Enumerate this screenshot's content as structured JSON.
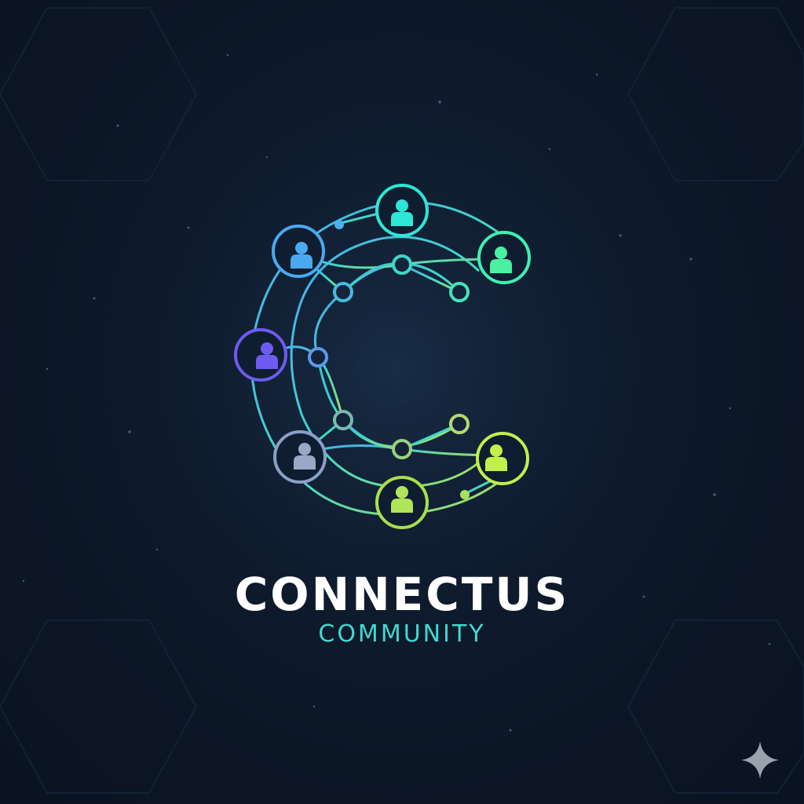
{
  "brand": {
    "name": "CONNECTUS",
    "tagline": "COMMUNITY"
  },
  "colors": {
    "background": "#0d1828",
    "name_text": "#ffffff",
    "tagline_text": "#3fd9d2",
    "gradient_cyan": "#2ee6d6",
    "gradient_blue": "#4aa8f0",
    "gradient_purple": "#6d5cf0",
    "gradient_lime": "#b8f04a",
    "gradient_green": "#5af0a0"
  },
  "icons": {
    "logo": "letter-c-people-network-logo",
    "people": "person-silhouette-icon",
    "corner": "four-point-sparkle-icon"
  }
}
